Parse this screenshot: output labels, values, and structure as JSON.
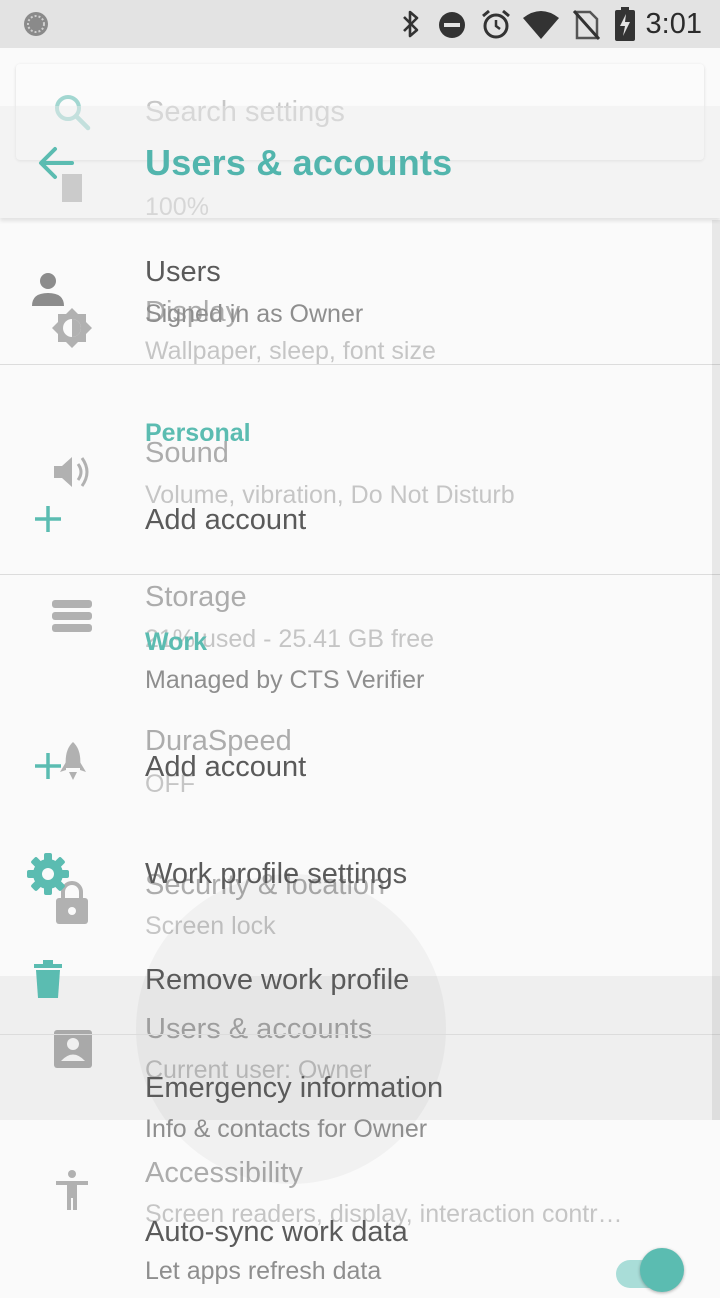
{
  "status_bar": {
    "time": "3:01"
  },
  "search": {
    "placeholder": "Search settings"
  },
  "background": {
    "battery_sub": "100%",
    "display": {
      "title": "Display",
      "subtitle": "Wallpaper, sleep, font size"
    },
    "sound": {
      "title": "Sound",
      "subtitle": "Volume, vibration, Do Not Disturb"
    },
    "storage": {
      "title": "Storage",
      "subtitle": "21% used - 25.41 GB free"
    },
    "duraspeed": {
      "title": "DuraSpeed",
      "subtitle": "OFF"
    },
    "security": {
      "title": "Security & location",
      "subtitle": "Screen lock"
    },
    "users": {
      "title": "Users & accounts",
      "subtitle": "Current user: Owner"
    },
    "accessibility": {
      "title": "Accessibility",
      "subtitle": "Screen readers, display, interaction contr…"
    }
  },
  "page": {
    "title": "Users & accounts",
    "users": {
      "title": "Users",
      "subtitle": "Signed in as Owner"
    },
    "personal": {
      "header": "Personal",
      "add_account": "Add account"
    },
    "work": {
      "header": "Work",
      "managed_by": "Managed by CTS Verifier",
      "add_account": "Add account",
      "profile_settings": "Work profile settings",
      "remove_profile": "Remove work profile"
    },
    "emergency": {
      "title": "Emergency information",
      "subtitle": "Info & contacts for Owner"
    },
    "auto_sync": {
      "title": "Auto-sync work data",
      "subtitle": "Let apps refresh data",
      "enabled": true
    }
  },
  "colors": {
    "accent": "#5bbcb1",
    "accent_light": "#a9ddd8"
  }
}
